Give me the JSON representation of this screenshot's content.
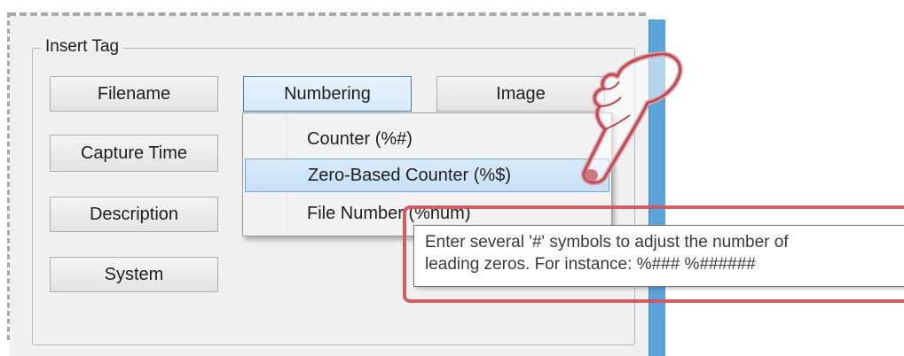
{
  "group": {
    "title": "Insert Tag"
  },
  "buttons": {
    "filename": "Filename",
    "numbering": "Numbering",
    "image": "Image",
    "capture_time": "Capture Time",
    "description": "Description",
    "system": "System"
  },
  "menu": {
    "items": [
      {
        "label": "Counter (%#)",
        "highlighted": false
      },
      {
        "label": "Zero-Based Counter (%$)",
        "highlighted": true
      },
      {
        "label": "File Number (%num)",
        "highlighted": false
      }
    ]
  },
  "tooltip": {
    "line1": "Enter several '#' symbols to adjust the number of",
    "line2": "leading zeros. For instance: %### %######"
  },
  "colors": {
    "panel_bg": "#f0f0f0",
    "accent_blue": "#5ba3db",
    "menu_highlight": "#c6e0f7",
    "annotation_red": "#d0565f"
  },
  "icons": {
    "pointer": "pointing-hand-icon"
  }
}
